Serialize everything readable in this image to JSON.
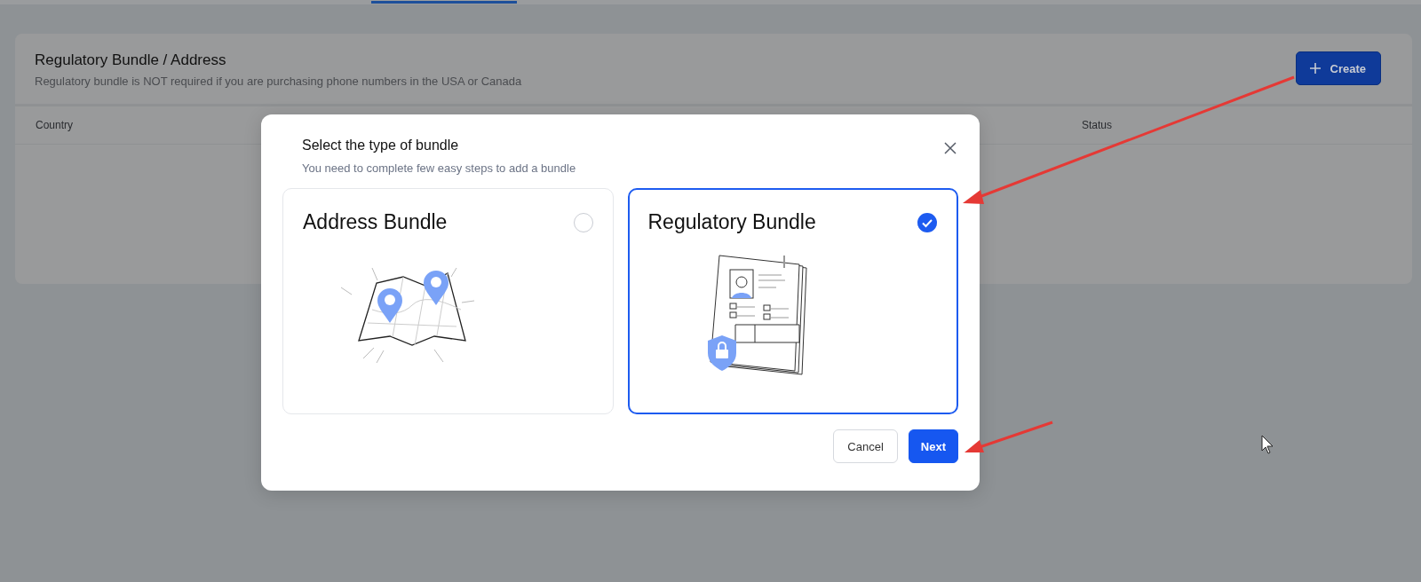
{
  "panel": {
    "title": "Regulatory Bundle / Address",
    "subtitle": "Regulatory bundle is NOT required if you are purchasing phone numbers in the USA or Canada",
    "create_button": {
      "label": "Create"
    },
    "table": {
      "columns": [
        "Country",
        "Status"
      ]
    }
  },
  "dialog": {
    "title": "Select the type of bundle",
    "subtitle": "You need to complete few easy steps to add a bundle",
    "options": [
      {
        "title": "Address Bundle",
        "kind": "map",
        "selected": false
      },
      {
        "title": "Regulatory Bundle",
        "kind": "document",
        "selected": true
      }
    ],
    "buttons": [
      {
        "label": "Cancel",
        "kind": "secondary"
      },
      {
        "label": "Next",
        "kind": "primary"
      }
    ]
  }
}
